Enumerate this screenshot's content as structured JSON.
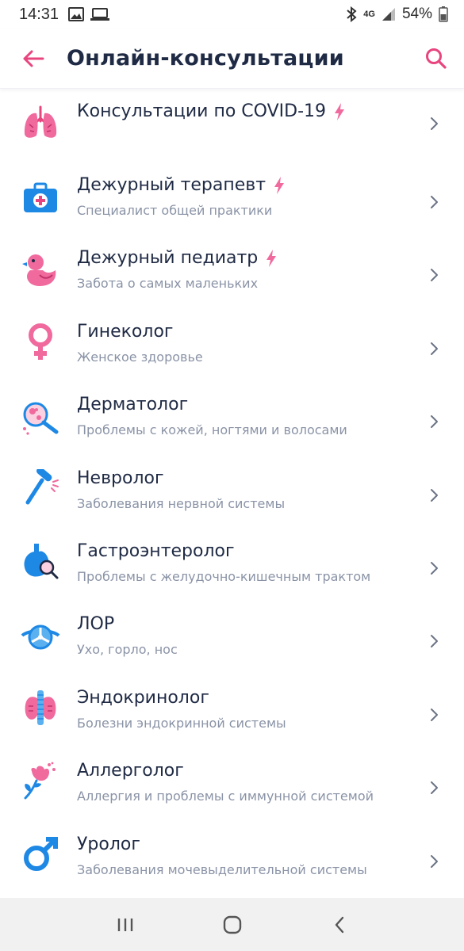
{
  "status_bar": {
    "time": "14:31",
    "network": "4G",
    "battery": "54%"
  },
  "header": {
    "title": "Онлайн-консультации"
  },
  "colors": {
    "accent": "#e8457f",
    "text": "#1f2a44",
    "subtext": "#8a93a6",
    "blue": "#1e88e5"
  },
  "list": [
    {
      "name": "Консультации по COVID-19",
      "sub": "",
      "icon": "lungs-icon",
      "urgent": true
    },
    {
      "name": "Дежурный терапевт",
      "sub": "Специалист общей практики",
      "icon": "first-aid-kit-icon",
      "urgent": true
    },
    {
      "name": "Дежурный педиатр",
      "sub": "Забота о самых маленьких",
      "icon": "rubber-duck-icon",
      "urgent": true
    },
    {
      "name": "Гинеколог",
      "sub": "Женское здоровье",
      "icon": "female-symbol-icon",
      "urgent": false
    },
    {
      "name": "Дерматолог",
      "sub": "Проблемы с кожей, ногтями и волосами",
      "icon": "magnifier-icon",
      "urgent": false
    },
    {
      "name": "Невролог",
      "sub": "Заболевания нервной системы",
      "icon": "reflex-hammer-icon",
      "urgent": false
    },
    {
      "name": "Гастроэнтеролог",
      "sub": "Проблемы с желудочно-кишечным трактом",
      "icon": "stomach-icon",
      "urgent": false
    },
    {
      "name": "ЛОР",
      "sub": "Ухо, горло, нос",
      "icon": "head-mirror-icon",
      "urgent": false
    },
    {
      "name": "Эндокринолог",
      "sub": "Болезни эндокринной системы",
      "icon": "thyroid-icon",
      "urgent": false
    },
    {
      "name": "Аллерголог",
      "sub": "Аллергия и проблемы с иммунной системой",
      "icon": "flower-icon",
      "urgent": false
    },
    {
      "name": "Уролог",
      "sub": "Заболевания мочевыделительной системы",
      "icon": "male-symbol-icon",
      "urgent": false
    }
  ]
}
